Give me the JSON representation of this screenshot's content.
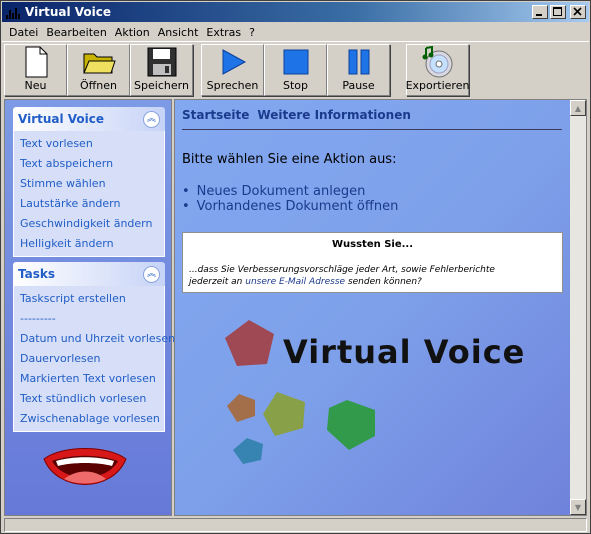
{
  "window": {
    "title": "Virtual Voice"
  },
  "menu": [
    "Datei",
    "Bearbeiten",
    "Aktion",
    "Ansicht",
    "Extras",
    "?"
  ],
  "toolbar": [
    {
      "label": "Neu",
      "icon": "new-document-icon"
    },
    {
      "label": "Öffnen",
      "icon": "folder-open-icon"
    },
    {
      "label": "Speichern",
      "icon": "floppy-disk-icon"
    },
    {
      "label": "Sprechen",
      "icon": "play-icon"
    },
    {
      "label": "Stop",
      "icon": "stop-icon"
    },
    {
      "label": "Pause",
      "icon": "pause-icon"
    },
    {
      "label": "Exportieren",
      "icon": "cd-music-icon"
    }
  ],
  "sidebar": {
    "panel1": {
      "title": "Virtual Voice",
      "items": [
        "Text vorlesen",
        "Text abspeichern",
        "Stimme wählen",
        "Lautstärke ändern",
        "Geschwindigkeit ändern",
        "Helligkeit ändern"
      ]
    },
    "panel2": {
      "title": "Tasks",
      "items": [
        "Taskscript erstellen",
        "---------",
        "Datum und Uhrzeit vorlesen",
        "Dauervorlesen",
        "Markierten Text vorlesen",
        "Text stündlich vorlesen",
        "Zwischenablage vorlesen"
      ]
    }
  },
  "content": {
    "nav": [
      "Startseite",
      "Weitere Informationen"
    ],
    "prompt": "Bitte wählen Sie eine Aktion aus:",
    "actions": [
      "Neues Dokument anlegen",
      "Vorhandenes Dokument öffnen"
    ],
    "did_you_know": {
      "title": "Wussten Sie...",
      "line1": "...dass Sie Verbesserungsvorschläge jeder Art, sowie Fehlerberichte",
      "line2_pre": "jederzeit an ",
      "line2_link": "unsere E-Mail Adresse",
      "line2_post": " senden können?"
    },
    "logo_text": "Virtual Voice"
  },
  "colors": {
    "title_gradient_start": "#0a246a",
    "link": "#215dc6",
    "pane_bg": "#6f81db"
  }
}
